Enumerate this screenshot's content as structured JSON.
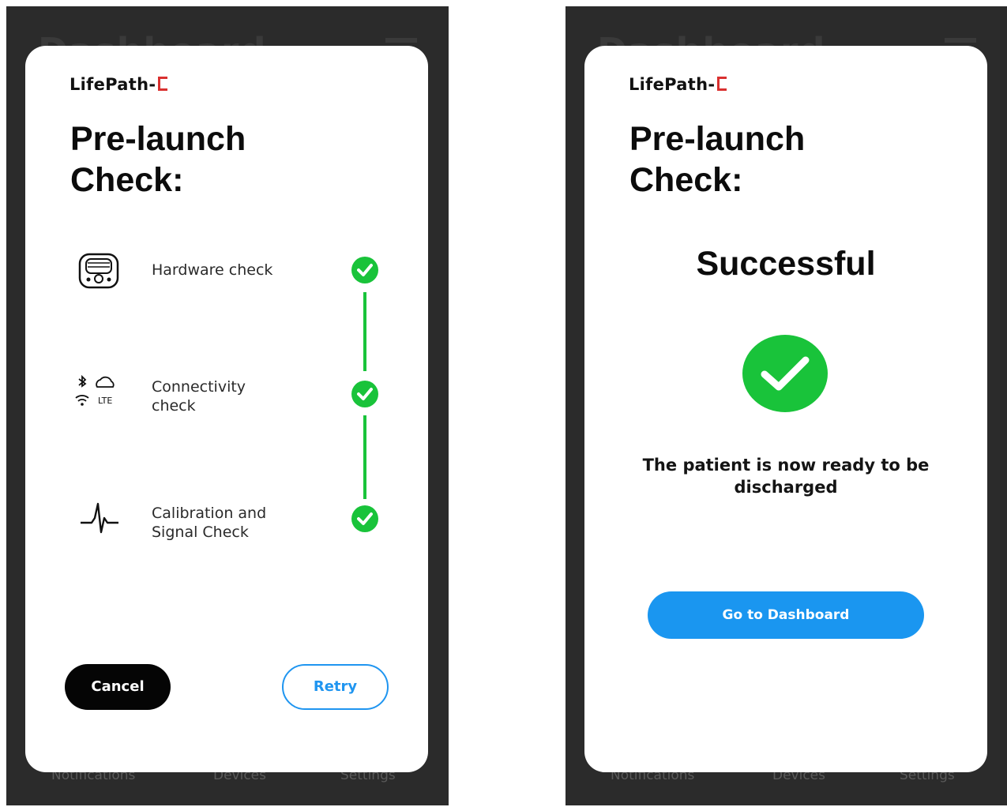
{
  "background_screen": {
    "tabs": [
      "Notifications",
      "Devices",
      "Settings"
    ]
  },
  "colors": {
    "success_green": "#19c33a",
    "primary_blue": "#1a96f0",
    "brand_red": "#d9302f",
    "dark_button": "#050505"
  },
  "left_screen": {
    "brand": "LifePath-",
    "title": "Pre-launch Check:",
    "checks": [
      {
        "label": "Hardware check",
        "status": "passed",
        "icon": "device-icon"
      },
      {
        "label": "Connectivity check",
        "status": "passed",
        "icon": "connectivity-icons",
        "sub_icon_label": "LTE"
      },
      {
        "label": "Calibration and Signal Check",
        "status": "passed",
        "icon": "heartbeat-icon"
      }
    ],
    "cancel_label": "Cancel",
    "retry_label": "Retry"
  },
  "right_screen": {
    "brand": "LifePath-",
    "title": "Pre-launch Check:",
    "status_title": "Successful",
    "message": "The patient is now ready to be discharged",
    "dashboard_label": "Go to Dashboard"
  }
}
